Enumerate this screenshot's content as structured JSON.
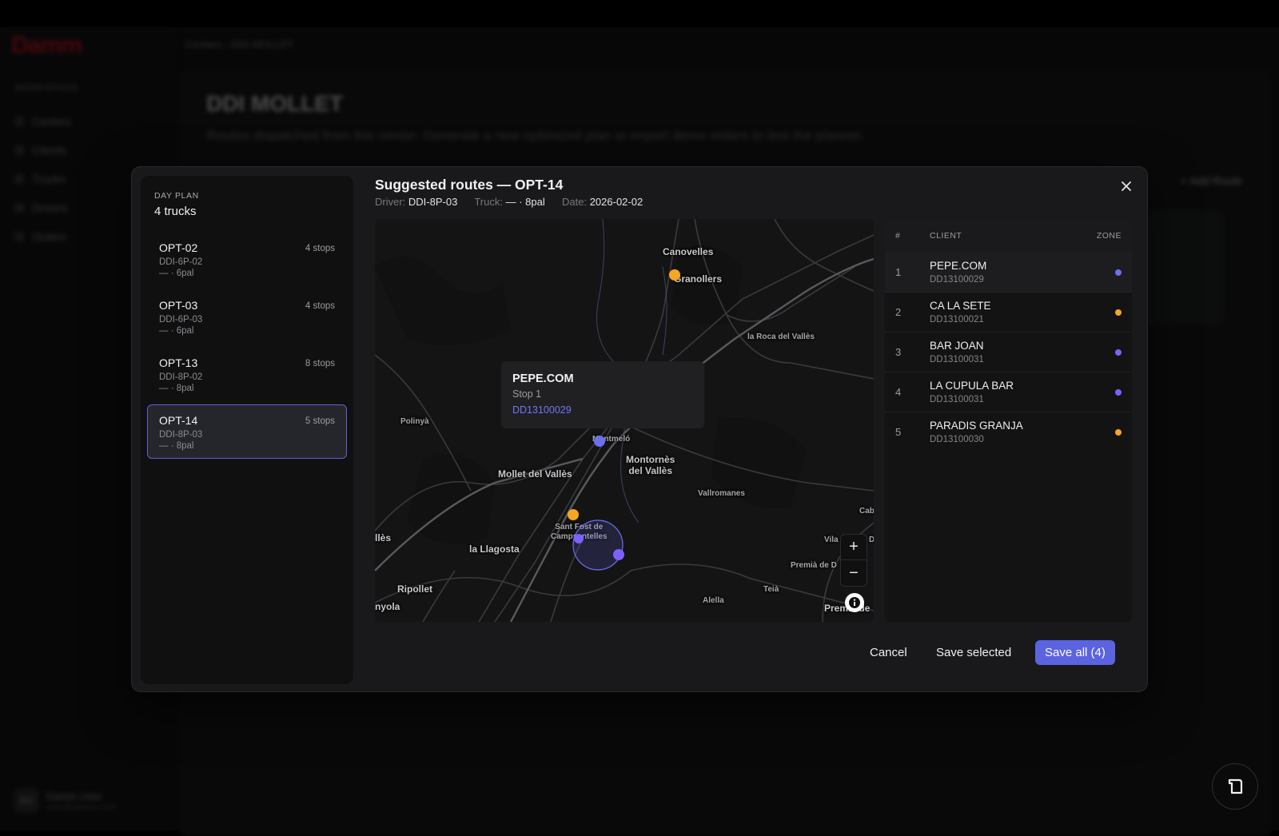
{
  "background": {
    "brand": "Damm",
    "section": "WORKSPACE",
    "nav": [
      "Centers",
      "Clients",
      "Trucks",
      "Drivers",
      "Orders"
    ],
    "breadcrumb": "Centers › DDI MOLLET",
    "title": "DDI MOLLET",
    "subtitle": "Routes dispatched from this center. Generate a new optimized plan or import demo orders to test the planner.",
    "action": "+ Add Route",
    "user_initials": "DU",
    "user_name": "Damm User",
    "user_email": "user@damm.com"
  },
  "day_plan": {
    "label": "DAY PLAN",
    "count": "4 trucks",
    "trucks": [
      {
        "name": "OPT-02",
        "stops": "4 stops",
        "driver": "DDI-6P-02",
        "pal": "— · 6pal",
        "selected": false
      },
      {
        "name": "OPT-03",
        "stops": "4 stops",
        "driver": "DDI-6P-03",
        "pal": "— · 6pal",
        "selected": false
      },
      {
        "name": "OPT-13",
        "stops": "8 stops",
        "driver": "DDI-8P-02",
        "pal": "— · 8pal",
        "selected": false
      },
      {
        "name": "OPT-14",
        "stops": "5 stops",
        "driver": "DDI-8P-03",
        "pal": "— · 8pal",
        "selected": true
      }
    ]
  },
  "modal": {
    "title": "Suggested routes — OPT-14",
    "driver_key": "Driver:",
    "driver_val": "DDI-8P-03",
    "truck_key": "Truck:",
    "truck_val": "— · 8pal",
    "date_key": "Date:",
    "date_val": "2026-02-02"
  },
  "map": {
    "labels": {
      "canovelles": "Canovelles",
      "granollers": "Granollers",
      "roca": "la Roca del Vallès",
      "polinya": "Polinyà",
      "montmelo": "Montmeló",
      "montornes": "Montornès\ndel Vallès",
      "mollet": "Mollet del Vallès",
      "vallromanes": "Vallromanes",
      "cab": "Cab",
      "santfost": "Sant Fost de\nCampsentelles",
      "vila": "Vila",
      "d": "D",
      "lles": "llès",
      "llagosta": "la Llagosta",
      "premia1": "Premià de D",
      "ripollet": "Ripollet",
      "alella": "Alella",
      "teia": "Teià",
      "premia2": "Premià de",
      "nyola": "nyola"
    },
    "popup": {
      "name": "PEPE.COM",
      "stop": "Stop 1",
      "code": "DD13100029"
    },
    "zoom_in": "+",
    "zoom_out": "−",
    "marker_colors": {
      "purple": "#6b6ff0",
      "orange": "#f5a623"
    }
  },
  "stops_table": {
    "headers": {
      "num": "#",
      "client": "CLIENT",
      "zone": "ZONE"
    },
    "rows": [
      {
        "num": "1",
        "client": "PEPE.COM",
        "code": "DD13100029",
        "zone_color": "#6b6ff0",
        "active": true
      },
      {
        "num": "2",
        "client": "CA LA SETE",
        "code": "DD13100021",
        "zone_color": "#f5a623",
        "active": false
      },
      {
        "num": "3",
        "client": "BAR JOAN",
        "code": "DD13100031",
        "zone_color": "#7b61ff",
        "active": false
      },
      {
        "num": "4",
        "client": "LA CUPULA BAR",
        "code": "DD13100031",
        "zone_color": "#7b61ff",
        "active": false
      },
      {
        "num": "5",
        "client": "PARADIS GRANJA",
        "code": "DD13100030",
        "zone_color": "#f5a623",
        "active": false
      }
    ]
  },
  "footer": {
    "cancel": "Cancel",
    "save_selected": "Save selected",
    "save_all": "Save all (4)"
  },
  "accent": "#5b63e0"
}
